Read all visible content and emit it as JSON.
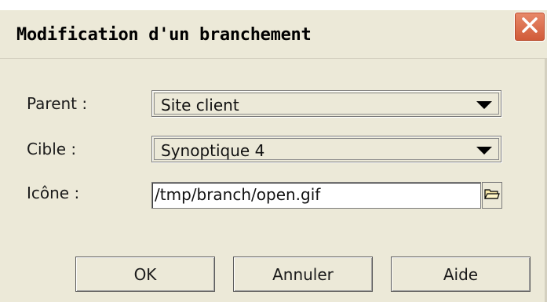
{
  "window": {
    "title": "Modification d'un branchement"
  },
  "form": {
    "parent_label": "Parent :",
    "parent_value": "Site client",
    "cible_label": "Cible :",
    "cible_value": "Synoptique 4",
    "icone_label": "Icône :",
    "icone_value": "/tmp/branch/open.gif"
  },
  "buttons": {
    "ok": "OK",
    "cancel": "Annuler",
    "help": "Aide"
  },
  "icons": {
    "close": "close-icon",
    "dropdown": "chevron-down-icon",
    "browse": "folder-open-icon"
  },
  "colors": {
    "dialog_bg": "#ece9d8",
    "close_button": "#d05a38"
  }
}
